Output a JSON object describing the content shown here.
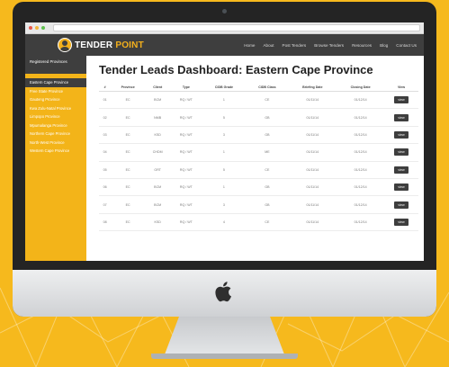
{
  "header": {
    "logo_part1": "TENDER",
    "logo_part2": "POINT",
    "nav": [
      "Home",
      "About",
      "Post Tenders",
      "Browse Tenders",
      "Resources",
      "Blog",
      "Contact Us"
    ]
  },
  "sidebar": {
    "heading": "Registered Provinces",
    "items": [
      "Eastern Cape Province",
      "Free State Province",
      "Gauteng Province",
      "Kwa Zulu-Natal Province",
      "Limpopo Province",
      "Mpumalanga Province",
      "Northern Cape Province",
      "North-West Province",
      "Western Cape Province"
    ]
  },
  "main": {
    "title_bold": "Tender Leads Dashboard:",
    "title_rest": " Eastern Cape Province",
    "columns": [
      "#",
      "Province",
      "Client",
      "Type",
      "CIDB Grade",
      "CIDB Class",
      "Briefing Date",
      "Closing Date",
      "View"
    ],
    "view_label": "view",
    "rows": [
      [
        "01",
        "EC",
        "BCM",
        "RQ / WT",
        "1",
        "CE",
        "01/11/14",
        "01/12/14"
      ],
      [
        "02",
        "EC",
        "NMB",
        "RQ / WT",
        "5",
        "GB",
        "01/11/14",
        "01/12/14"
      ],
      [
        "03",
        "EC",
        "KSD",
        "RQ / WT",
        "3",
        "GB",
        "01/11/14",
        "01/12/14"
      ],
      [
        "04",
        "EC",
        "CHDM",
        "RQ / WT",
        "1",
        "ME",
        "01/11/14",
        "01/12/14"
      ],
      [
        "05",
        "EC",
        "ORT",
        "RQ / WT",
        "5",
        "CE",
        "01/11/14",
        "01/12/14"
      ],
      [
        "06",
        "EC",
        "BCM",
        "RQ / WT",
        "1",
        "GB",
        "01/11/14",
        "01/12/14"
      ],
      [
        "07",
        "EC",
        "BCM",
        "RQ / WT",
        "3",
        "GB",
        "01/11/14",
        "01/12/14"
      ],
      [
        "08",
        "EC",
        "KSD",
        "RQ / WT",
        "4",
        "CE",
        "01/11/14",
        "01/12/14"
      ]
    ]
  },
  "colors": {
    "accent": "#f3b419",
    "dark": "#3e3e3e"
  }
}
